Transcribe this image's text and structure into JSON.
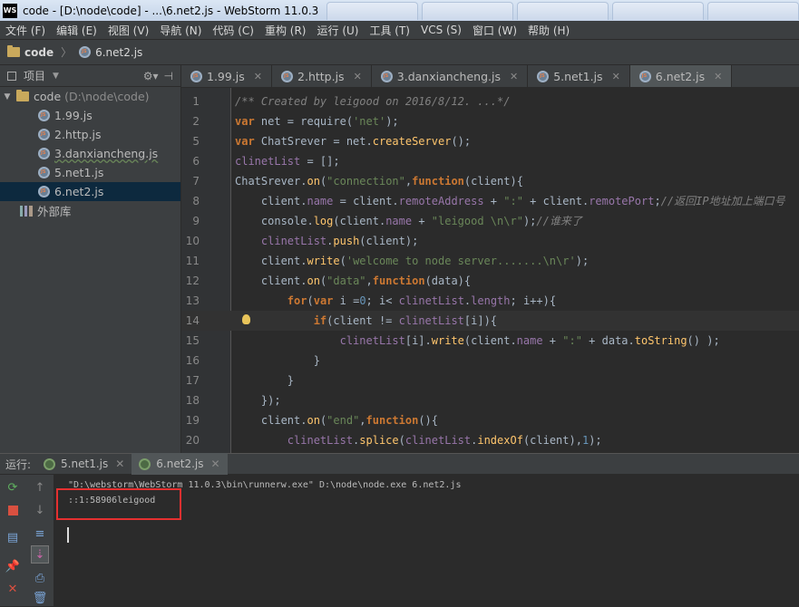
{
  "window": {
    "title": "code - [D:\\node\\code] - ...\\6.net2.js - WebStorm 11.0.3",
    "logo": "WS"
  },
  "menu": [
    "文件 (F)",
    "编辑 (E)",
    "视图 (V)",
    "导航 (N)",
    "代码 (C)",
    "重构 (R)",
    "运行 (U)",
    "工具 (T)",
    "VCS (S)",
    "窗口 (W)",
    "帮助 (H)"
  ],
  "nav": {
    "root": "code",
    "file": "6.net2.js"
  },
  "project": {
    "title": "项目",
    "root_label": "code",
    "root_path": "(D:\\node\\code)",
    "files": [
      "1.99.js",
      "2.http.js",
      "3.danxiancheng.js",
      "5.net1.js",
      "6.net2.js"
    ],
    "selected": "6.net2.js",
    "external": "外部库"
  },
  "tabs": [
    {
      "label": "1.99.js",
      "active": false
    },
    {
      "label": "2.http.js",
      "active": false
    },
    {
      "label": "3.danxiancheng.js",
      "active": false
    },
    {
      "label": "5.net1.js",
      "active": false
    },
    {
      "label": "6.net2.js",
      "active": true
    }
  ],
  "code_lines": [
    {
      "n": "1",
      "html": "<span class=\"cm\">/** Created by leigood on 2016/8/12. ...*/</span>"
    },
    {
      "n": "2",
      "html": "<span class=\"kw\">var</span> net = require(<span class=\"str\">'net'</span>);"
    },
    {
      "n": "5",
      "html": "<span class=\"kw\">var</span> ChatSrever = net.<span class=\"fn\">createServer</span>();"
    },
    {
      "n": "6",
      "html": "<span class=\"prop\">clinetList</span> = [];"
    },
    {
      "n": "7",
      "html": "ChatSrever.<span class=\"fn\">on</span>(<span class=\"str\">\"connection\"</span>,<span class=\"kw\">function</span>(client){"
    },
    {
      "n": "8",
      "html": "    client.<span class=\"prop\">name</span> = client.<span class=\"prop\">remoteAddress</span> + <span class=\"str\">\":\"</span> + client.<span class=\"prop\">remotePort</span>;<span class=\"cm\">//返回IP地址加上端口号</span>"
    },
    {
      "n": "9",
      "html": "    console.<span class=\"fn\">log</span>(client.<span class=\"prop\">name</span> + <span class=\"str\">\"leigood \\n\\r\"</span>);<span class=\"cm\">//谁来了</span>"
    },
    {
      "n": "10",
      "html": "    <span class=\"prop\">clinetList</span>.<span class=\"fn\">push</span>(client);"
    },
    {
      "n": "11",
      "html": "    client.<span class=\"fn\">write</span>(<span class=\"str\">'welcome to node server.......\\n\\r'</span>);"
    },
    {
      "n": "12",
      "html": "    client.<span class=\"fn\">on</span>(<span class=\"str\">\"data\"</span>,<span class=\"kw\">function</span>(data){"
    },
    {
      "n": "13",
      "html": "        <span class=\"kw\">for</span>(<span class=\"kw\">var</span> i =<span class=\"num\">0</span>; i&lt; <span class=\"prop\">clinetList</span>.<span class=\"prop\">length</span>; i++){"
    },
    {
      "n": "14",
      "html": "            <span class=\"kw\">if</span>(client != <span class=\"prop\">clinetList</span>[i]){"
    },
    {
      "n": "15",
      "html": "                <span class=\"prop\">clinetList</span>[i].<span class=\"fn\">write</span>(client.<span class=\"prop\">name</span> + <span class=\"str\">\":\"</span> + data.<span class=\"fn\">toString</span>() );"
    },
    {
      "n": "16",
      "html": "            }"
    },
    {
      "n": "17",
      "html": "        }"
    },
    {
      "n": "18",
      "html": "    });"
    },
    {
      "n": "19",
      "html": "    client.<span class=\"fn\">on</span>(<span class=\"str\">\"end\"</span>,<span class=\"kw\">function</span>(){"
    },
    {
      "n": "20",
      "html": "        <span class=\"prop\">clinetList</span>.<span class=\"fn\">splice</span>(<span class=\"prop\">clinetList</span>.<span class=\"fn\">indexOf</span>(client),<span class=\"num\">1</span>);"
    }
  ],
  "run": {
    "label": "运行:",
    "tabs": [
      "5.net1.js",
      "6.net2.js"
    ],
    "active_tab": "6.net2.js",
    "command": "\"D:\\webstorm\\WebStorm 11.0.3\\bin\\runnerw.exe\" D:\\node\\node.exe 6.net2.js",
    "output": "::1:58906leigood"
  },
  "colors": {
    "accent_highlight": "#e53030",
    "selection": "#0d293e"
  }
}
